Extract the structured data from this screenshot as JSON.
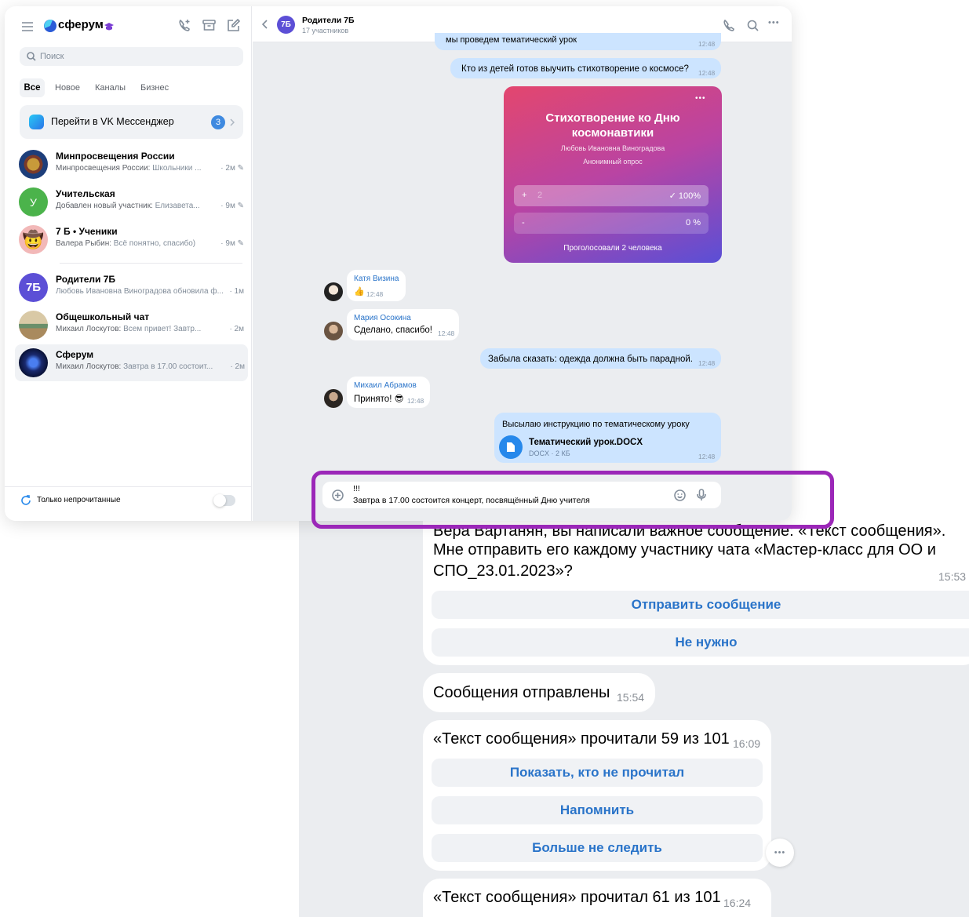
{
  "zoom": {
    "top_line": "Вера Вартанян, вы написали важное сообщение: «Текст сообщения».",
    "question_line1": "Мне отправить его каждому участнику чата «Мастер-класс для ОО и",
    "question_line2": "СПО_23.01.2023»?",
    "question_time": "15:53",
    "btn_send": "Отправить сообщение",
    "btn_no": "Не нужно",
    "sent_text": "Сообщения отправлены",
    "sent_time": "15:54",
    "read1_text": "«Текст сообщения» прочитали 59 из 101",
    "read1_time": "16:09",
    "btn_show": "Показать, кто не прочитал",
    "btn_remind": "Напомнить",
    "btn_stop": "Больше не следить",
    "more_icon": "•••",
    "read2_text": "«Текст сообщения» прочитал 61 из 101",
    "read2_time": "16:24"
  },
  "sidebar": {
    "brand": "сферум",
    "search_placeholder": "Поиск",
    "tabs": [
      "Все",
      "Новое",
      "Каналы",
      "Бизнес"
    ],
    "vk_banner": {
      "label": "Перейти в VK Мессенджер",
      "badge": "3"
    },
    "chats": [
      {
        "name": "Минпросвещения России",
        "sender": "Минпросвещения России:",
        "preview": " Школьники ...",
        "time": "· 2м"
      },
      {
        "name": "Учительская",
        "sender": "Добавлен новый участник:",
        "preview": " Елизавета...",
        "time": "· 9м",
        "avatar_letter": "У"
      },
      {
        "name": "7 Б • Ученики",
        "sender": "Валера Рыбин:",
        "preview": " Всё понятно, спасибо)",
        "time": "· 9м"
      },
      {
        "name": "Родители 7Б",
        "sender": "",
        "preview": "Любовь Ивановна Виноградова обновила ф...",
        "time": "· 1м",
        "avatar_letter": "7Б"
      },
      {
        "name": "Общешкольный чат",
        "sender": "Михаил Лоскутов:",
        "preview": " Всем привет! Завтр...",
        "time": "· 2м"
      },
      {
        "name": "Сферум",
        "sender": "Михаил Лоскутов:",
        "preview": " Завтра в 17.00 состоит...",
        "time": "· 2м"
      }
    ],
    "unread_only": "Только непрочитанные"
  },
  "chat": {
    "title": "Родители 7Б",
    "subtitle": "17 участников",
    "avatar": "7Б",
    "partial_msg": "мы проведем тематический урок",
    "partial_time": "12:48",
    "msg1": {
      "text": "Кто из детей готов выучить стихотворение о космосе?",
      "time": "12:48"
    },
    "poll": {
      "title1": "Стихотворение ко Дню",
      "title2": "космонавтики",
      "author": "Любовь Ивановна Виноградова",
      "kind": "Анонимный опрос",
      "options": [
        {
          "mark": "+",
          "text": "2",
          "result": "✓ 100%"
        },
        {
          "mark": "-",
          "text": "",
          "result": "0 %"
        }
      ],
      "voted": "Проголосовали 2 человека",
      "menu": "•••"
    },
    "katya": {
      "name": "Катя Визина",
      "text": "👍",
      "time": "12:48"
    },
    "maria": {
      "name": "Мария Осокина",
      "text": "Сделано, спасибо!",
      "time": "12:48"
    },
    "msg2": {
      "text": "Забыла сказать: одежда должна быть парадной.",
      "time": "12:48"
    },
    "mikhail": {
      "name": "Михаил Абрамов",
      "text": "Принято! 😎",
      "time": "12:48"
    },
    "file_msg": {
      "text": "Высылаю инструкцию по тематическому уроку",
      "file_name": "Тематический урок.DOCX",
      "file_meta": "DOCX · 2 КБ",
      "time": "12:48"
    },
    "composer": {
      "line1": "!!!",
      "line2": "Завтра в 17.00 состоится концерт, посвящённый Дню учителя"
    }
  },
  "colors": {
    "highlight": "#9b27b8",
    "accent": "#2688eb",
    "bubble_out": "#cce4ff"
  }
}
